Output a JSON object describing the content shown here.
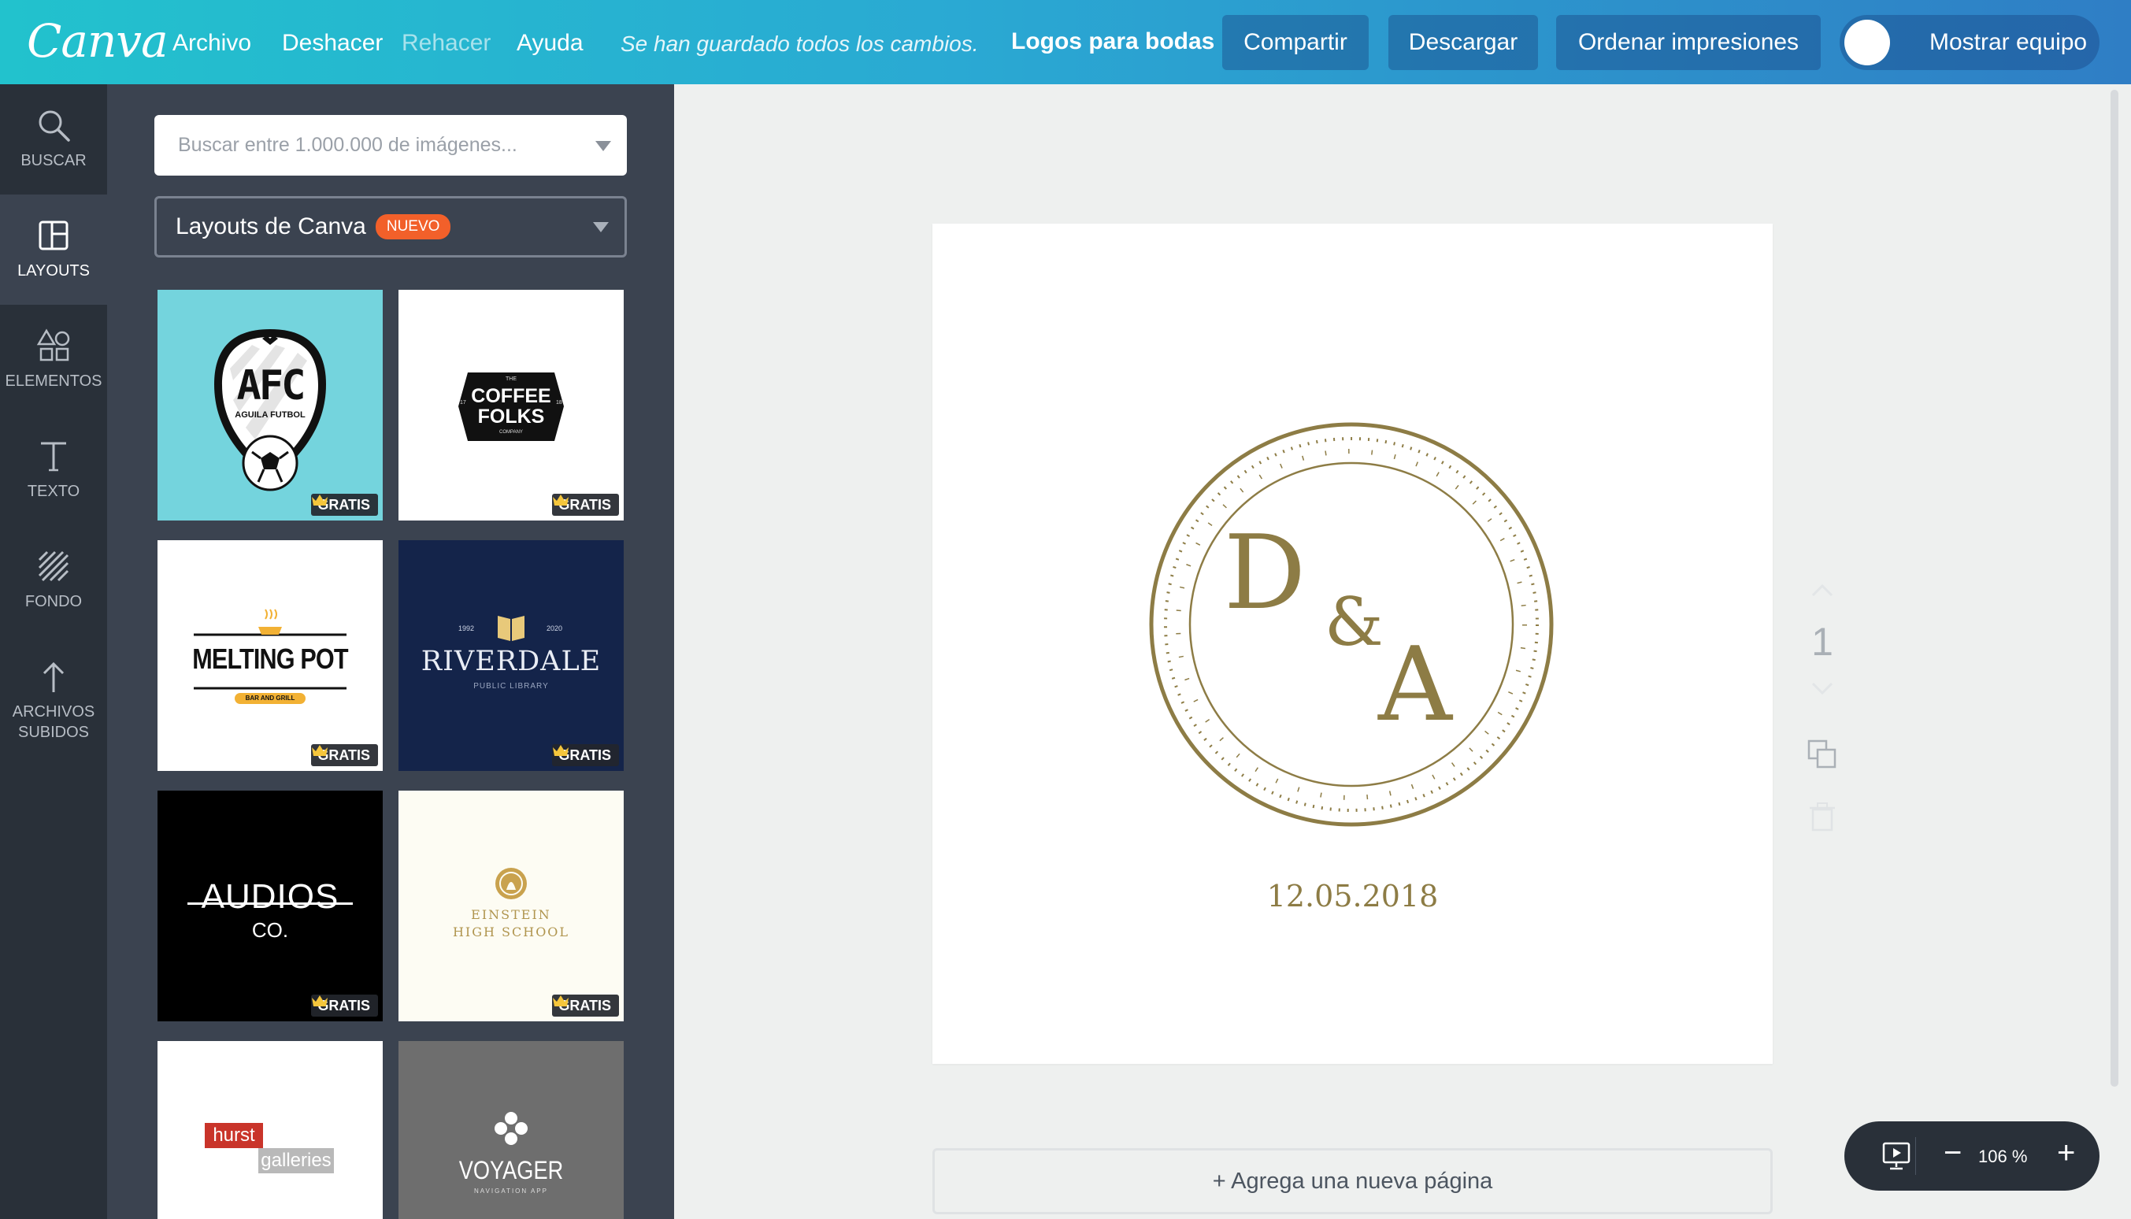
{
  "topbar": {
    "logo": "Canva",
    "menu": [
      "Archivo",
      "Deshacer",
      "Rehacer",
      "Ayuda"
    ],
    "saved_status": "Se han guardado todos los cambios.",
    "doc_title": "Logos para bodas",
    "share": "Compartir",
    "download": "Descargar",
    "order_prints": "Ordenar impresiones",
    "show_team": "Mostrar equipo"
  },
  "rail": [
    "BUSCAR",
    "LAYOUTS",
    "ELEMENTOS",
    "TEXTO",
    "FONDO",
    "ARCHIVOS SUBIDOS"
  ],
  "panel": {
    "search_placeholder": "Buscar entre 1.000.000 de imágenes...",
    "layout_select": "Layouts de Canva",
    "new_badge": "NUEVO",
    "free_badge": "GRATIS",
    "tiles": {
      "afc": {
        "big": "AFC",
        "small": "AGUILA FUTBOL"
      },
      "coffee": {
        "top": "THE",
        "line1": "COFFEE",
        "line2": "FOLKS",
        "left": "17",
        "right": "18",
        "bottom": "COMPANY"
      },
      "melting": {
        "name": "MELTING POT",
        "sub": "BAR AND GRILL"
      },
      "riverdale": {
        "left": "1992",
        "right": "2020",
        "name": "RIVERDALE",
        "sub": "PUBLIC LIBRARY"
      },
      "audios": {
        "line1": "AUDIOS",
        "line2": "CO."
      },
      "einstein": {
        "line1": "EINSTEIN",
        "line2": "HIGH SCHOOL"
      },
      "hurst": {
        "line1": "hurst",
        "line2": "galleries"
      },
      "voyager": {
        "name": "VOYAGER",
        "sub": "NAVIGATION APP"
      }
    }
  },
  "design": {
    "initial1": "D",
    "amp": "&",
    "initial2": "A",
    "date": "12.05.2018",
    "accent_color": "#8d7c45"
  },
  "page_number": "1",
  "add_page": "+ Agrega una nueva página",
  "zoom": "106 %",
  "colors": {
    "topbar_start": "#22c2cd",
    "topbar_end": "#2f7ec5",
    "rail": "#293039",
    "panel": "#3b4350",
    "new_badge": "#f2602a"
  }
}
